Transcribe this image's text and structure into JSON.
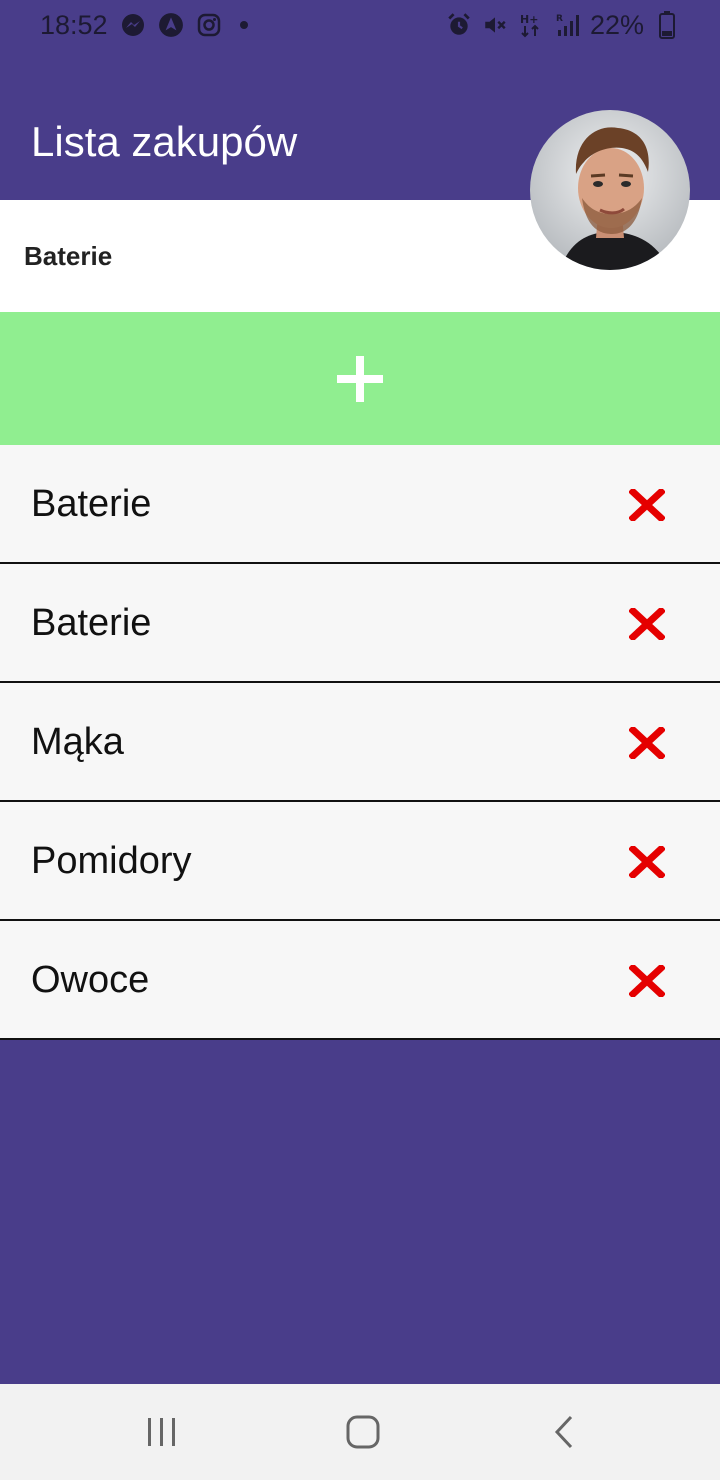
{
  "status_bar": {
    "time": "18:52",
    "battery": "22%",
    "left_icons": [
      "messenger-icon",
      "arrow-app-icon",
      "instagram-icon",
      "dot-icon"
    ],
    "right_icons": [
      "alarm-icon",
      "vibrate-icon",
      "hplus-icon",
      "signal-icon",
      "battery-icon"
    ]
  },
  "header": {
    "title": "Lista zakupów",
    "avatar_icon": "user-avatar"
  },
  "input": {
    "value": "Baterie",
    "placeholder": ""
  },
  "add_button": {
    "icon": "plus-icon"
  },
  "items": [
    {
      "label": "Baterie"
    },
    {
      "label": "Baterie"
    },
    {
      "label": "Mąka"
    },
    {
      "label": "Pomidory"
    },
    {
      "label": "Owoce"
    }
  ],
  "colors": {
    "primary": "#493D8A",
    "add_button": "#90EE90",
    "delete": "#E50000",
    "list_bg": "#F7F7F7"
  },
  "nav_bar": {
    "buttons": [
      "recent-apps-icon",
      "home-icon",
      "back-icon"
    ]
  }
}
